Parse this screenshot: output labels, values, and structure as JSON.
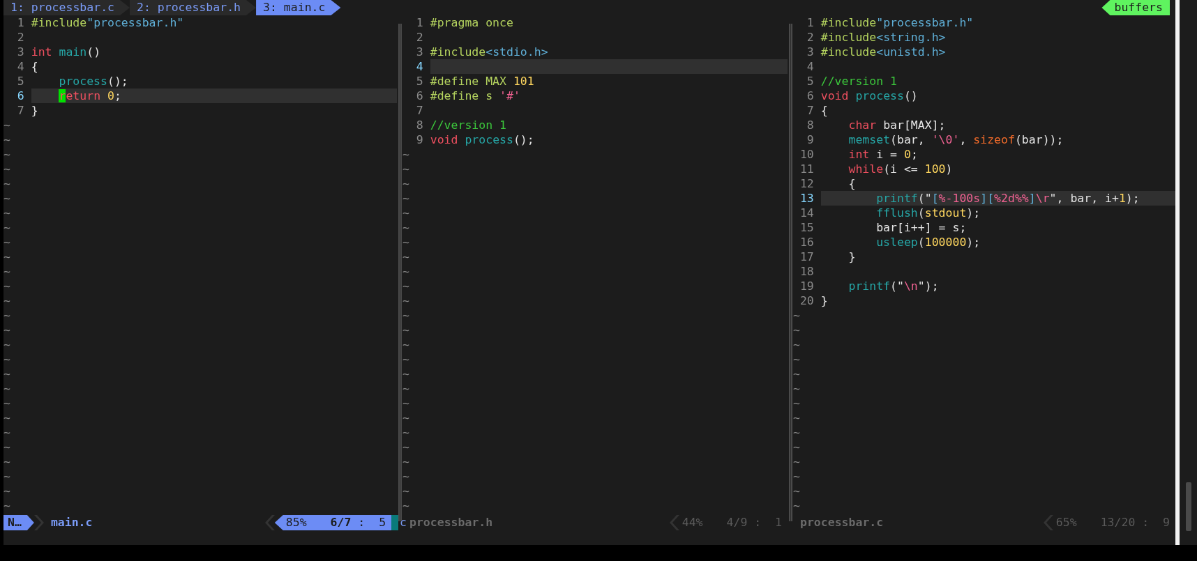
{
  "tabs": [
    {
      "label": "1: processbar.c",
      "selected": false
    },
    {
      "label": "2: processbar.h",
      "selected": false
    },
    {
      "label": "3: main.c",
      "selected": true
    }
  ],
  "buffers_label": "buffers",
  "panes": [
    {
      "active": true,
      "lines": [
        {
          "number": "1",
          "current": false,
          "tokens": [
            {
              "text": "#include",
              "kind": "preproc"
            },
            {
              "text": "\"processbar.h\"",
              "kind": "include"
            }
          ]
        },
        {
          "number": "2",
          "current": false
        },
        {
          "number": "3",
          "current": false,
          "tokens": [
            {
              "text": "int ",
              "kind": "keyword"
            },
            {
              "text": "main",
              "kind": "func"
            },
            {
              "text": "()",
              "kind": "plain"
            }
          ]
        },
        {
          "number": "4",
          "current": false,
          "tokens": [
            {
              "text": "{",
              "kind": "plain"
            }
          ]
        },
        {
          "number": "5",
          "current": false,
          "tokens": [
            {
              "text": "    process",
              "kind": "func"
            },
            {
              "text": "();",
              "kind": "plain"
            }
          ]
        },
        {
          "number": "6",
          "current": true,
          "tokens": [
            {
              "text": "    r",
              "kind": "cursor"
            },
            {
              "text": "eturn ",
              "kind": "keyword"
            },
            {
              "text": "0",
              "kind": "number"
            },
            {
              "text": ";",
              "kind": "plain"
            }
          ]
        },
        {
          "number": "7",
          "current": false,
          "tokens": [
            {
              "text": "}",
              "kind": "plain"
            }
          ]
        }
      ],
      "filler": [
        "~",
        "~",
        "~",
        "~",
        "~",
        "~",
        "~",
        "~",
        "~",
        "~",
        "~",
        "~",
        "~",
        "~",
        "~",
        "~",
        "~",
        "~",
        "~",
        "~",
        "~",
        "~",
        "~",
        "~",
        "~",
        "~",
        "~"
      ],
      "status": {
        "mode": "N…",
        "filename": "main.c",
        "percent": "85%",
        "position": "**6/7** :  5",
        "filetype": "c"
      }
    },
    {
      "active": false,
      "lines": [
        {
          "number": "1",
          "current": false,
          "tokens": [
            {
              "text": "#pragma once",
              "kind": "preproc"
            }
          ]
        },
        {
          "number": "2",
          "current": false
        },
        {
          "number": "3",
          "current": false,
          "tokens": [
            {
              "text": "#include",
              "kind": "preproc"
            },
            {
              "text": "<stdio.h>",
              "kind": "include"
            }
          ]
        },
        {
          "number": "4",
          "current": true
        },
        {
          "number": "5",
          "current": false,
          "tokens": [
            {
              "text": "#define MAX ",
              "kind": "preproc"
            },
            {
              "text": "101",
              "kind": "number"
            }
          ]
        },
        {
          "number": "6",
          "current": false,
          "tokens": [
            {
              "text": "#define s ",
              "kind": "preproc"
            },
            {
              "text": "'#'",
              "kind": "string"
            }
          ]
        },
        {
          "number": "7",
          "current": false
        },
        {
          "number": "8",
          "current": false,
          "tokens": [
            {
              "text": "//version 1",
              "kind": "comment"
            }
          ]
        },
        {
          "number": "9",
          "current": false,
          "tokens": [
            {
              "text": "void ",
              "kind": "keyword"
            },
            {
              "text": "process",
              "kind": "func"
            },
            {
              "text": "();",
              "kind": "plain"
            }
          ]
        }
      ],
      "filler": [
        "~",
        "~",
        "~",
        "~",
        "~",
        "~",
        "~",
        "~",
        "~",
        "~",
        "~",
        "~",
        "~",
        "~",
        "~",
        "~",
        "~",
        "~",
        "~",
        "~",
        "~",
        "~",
        "~",
        "~",
        "~"
      ],
      "status": {
        "filename": "processbar.h",
        "percent": "44%",
        "position": "4/9 :  1"
      }
    },
    {
      "active": false,
      "lines": [
        {
          "number": "1",
          "current": false,
          "tokens": [
            {
              "text": "#include",
              "kind": "preproc"
            },
            {
              "text": "\"processbar.h\"",
              "kind": "include"
            }
          ]
        },
        {
          "number": "2",
          "current": false,
          "tokens": [
            {
              "text": "#include",
              "kind": "preproc"
            },
            {
              "text": "<string.h>",
              "kind": "include"
            }
          ]
        },
        {
          "number": "3",
          "current": false,
          "tokens": [
            {
              "text": "#include",
              "kind": "preproc"
            },
            {
              "text": "<unistd.h>",
              "kind": "include"
            }
          ]
        },
        {
          "number": "4",
          "current": false
        },
        {
          "number": "5",
          "current": false,
          "tokens": [
            {
              "text": "//version 1",
              "kind": "comment"
            }
          ]
        },
        {
          "number": "6",
          "current": false,
          "tokens": [
            {
              "text": "void ",
              "kind": "keyword"
            },
            {
              "text": "process",
              "kind": "func"
            },
            {
              "text": "()",
              "kind": "plain"
            }
          ]
        },
        {
          "number": "7",
          "current": false,
          "tokens": [
            {
              "text": "{",
              "kind": "plain"
            }
          ]
        },
        {
          "number": "8",
          "current": false,
          "tokens": [
            {
              "text": "    char ",
              "kind": "keyword"
            },
            {
              "text": "bar[MAX];",
              "kind": "plain"
            }
          ]
        },
        {
          "number": "9",
          "current": false,
          "tokens": [
            {
              "text": "    memset",
              "kind": "func"
            },
            {
              "text": "(bar, ",
              "kind": "plain"
            },
            {
              "text": "'\\0'",
              "kind": "string"
            },
            {
              "text": ", ",
              "kind": "plain"
            },
            {
              "text": "sizeof",
              "kind": "operator"
            },
            {
              "text": "(bar));",
              "kind": "plain"
            }
          ]
        },
        {
          "number": "10",
          "current": false,
          "tokens": [
            {
              "text": "    int ",
              "kind": "keyword"
            },
            {
              "text": "i = ",
              "kind": "plain"
            },
            {
              "text": "0",
              "kind": "number"
            },
            {
              "text": ";",
              "kind": "plain"
            }
          ]
        },
        {
          "number": "11",
          "current": false,
          "tokens": [
            {
              "text": "    while",
              "kind": "keyword"
            },
            {
              "text": "(i <= ",
              "kind": "plain"
            },
            {
              "text": "100",
              "kind": "number"
            },
            {
              "text": ")",
              "kind": "plain"
            }
          ]
        },
        {
          "number": "12",
          "current": false,
          "tokens": [
            {
              "text": "    {",
              "kind": "plain"
            }
          ]
        },
        {
          "number": "13",
          "current": true,
          "tokens": [
            {
              "text": "        printf",
              "kind": "func"
            },
            {
              "text": "(\"",
              "kind": "plain"
            },
            {
              "text": "[",
              "kind": "include"
            },
            {
              "text": "%-100s",
              "kind": "string"
            },
            {
              "text": "][",
              "kind": "include"
            },
            {
              "text": "%2d%%",
              "kind": "string"
            },
            {
              "text": "]",
              "kind": "include"
            },
            {
              "text": "\\r",
              "kind": "string"
            },
            {
              "text": "\", bar, i+",
              "kind": "plain"
            },
            {
              "text": "1",
              "kind": "number"
            },
            {
              "text": ");",
              "kind": "plain"
            }
          ]
        },
        {
          "number": "14",
          "current": false,
          "tokens": [
            {
              "text": "        fflush",
              "kind": "func"
            },
            {
              "text": "(",
              "kind": "plain"
            },
            {
              "text": "stdout",
              "kind": "number"
            },
            {
              "text": ");",
              "kind": "plain"
            }
          ]
        },
        {
          "number": "15",
          "current": false,
          "tokens": [
            {
              "text": "        bar[i++] = s;",
              "kind": "plain"
            }
          ]
        },
        {
          "number": "16",
          "current": false,
          "tokens": [
            {
              "text": "        usleep",
              "kind": "func"
            },
            {
              "text": "(",
              "kind": "plain"
            },
            {
              "text": "100000",
              "kind": "number"
            },
            {
              "text": ");",
              "kind": "plain"
            }
          ]
        },
        {
          "number": "17",
          "current": false,
          "tokens": [
            {
              "text": "    }",
              "kind": "plain"
            }
          ]
        },
        {
          "number": "18",
          "current": false
        },
        {
          "number": "19",
          "current": false,
          "tokens": [
            {
              "text": "    printf",
              "kind": "func"
            },
            {
              "text": "(\"",
              "kind": "plain"
            },
            {
              "text": "\\n",
              "kind": "string"
            },
            {
              "text": "\");",
              "kind": "plain"
            }
          ]
        },
        {
          "number": "20",
          "current": false,
          "tokens": [
            {
              "text": "}",
              "kind": "plain"
            }
          ]
        }
      ],
      "filler": [
        "~",
        "~",
        "~",
        "~",
        "~",
        "~",
        "~",
        "~",
        "~",
        "~",
        "~",
        "~",
        "~",
        "~"
      ],
      "status": {
        "filename": "processbar.c",
        "percent": "65%",
        "position": "13/20 :  9"
      }
    }
  ]
}
